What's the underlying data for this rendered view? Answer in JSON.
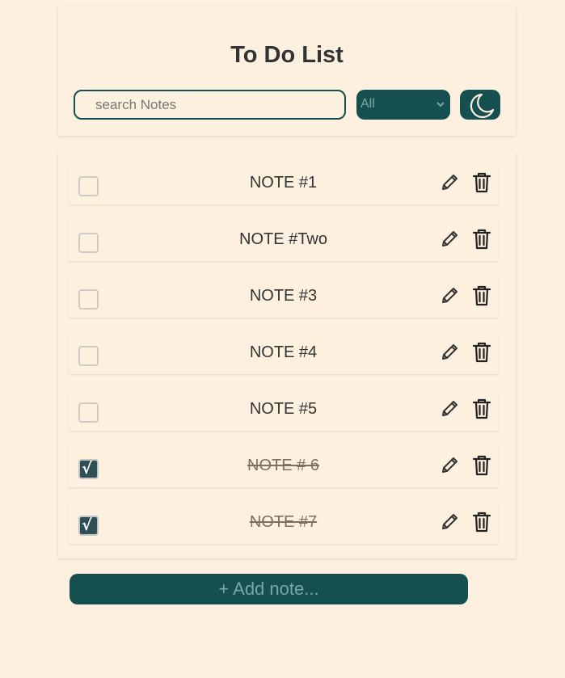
{
  "header": {
    "title": "To Do List",
    "search_placeholder": "search Notes",
    "search_value": "",
    "filter_selected": "All",
    "theme_icon": "moon-icon"
  },
  "notes": [
    {
      "text": "NOTE #1",
      "done": false
    },
    {
      "text": "NOTE #Two",
      "done": false
    },
    {
      "text": "NOTE #3",
      "done": false
    },
    {
      "text": "NOTE #4",
      "done": false
    },
    {
      "text": "NOTE #5",
      "done": false
    },
    {
      "text": "NOTE # 6",
      "done": true
    },
    {
      "text": "NOTE #7",
      "done": true
    }
  ],
  "add_button_label": "+ Add note...",
  "colors": {
    "background": "#fdf0de",
    "accent": "#164f4f",
    "text": "#333333"
  }
}
